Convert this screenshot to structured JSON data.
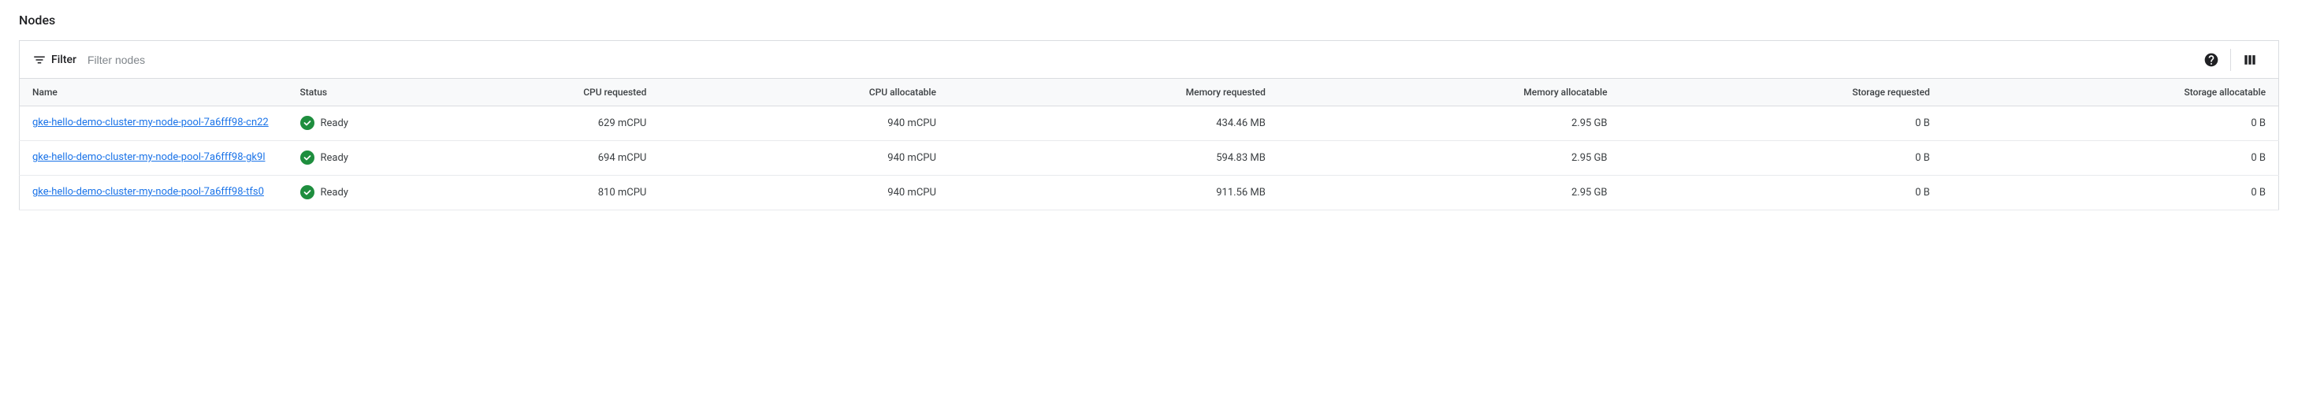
{
  "section_title": "Nodes",
  "toolbar": {
    "filter_label": "Filter",
    "filter_placeholder": "Filter nodes"
  },
  "table": {
    "headers": {
      "name": "Name",
      "status": "Status",
      "cpu_requested": "CPU requested",
      "cpu_allocatable": "CPU allocatable",
      "memory_requested": "Memory requested",
      "memory_allocatable": "Memory allocatable",
      "storage_requested": "Storage requested",
      "storage_allocatable": "Storage allocatable"
    },
    "rows": [
      {
        "name": "gke-hello-demo-cluster-my-node-pool-7a6fff98-cn22",
        "status": "Ready",
        "cpu_requested": "629 mCPU",
        "cpu_allocatable": "940 mCPU",
        "memory_requested": "434.46 MB",
        "memory_allocatable": "2.95 GB",
        "storage_requested": "0 B",
        "storage_allocatable": "0 B"
      },
      {
        "name": "gke-hello-demo-cluster-my-node-pool-7a6fff98-gk9l",
        "status": "Ready",
        "cpu_requested": "694 mCPU",
        "cpu_allocatable": "940 mCPU",
        "memory_requested": "594.83 MB",
        "memory_allocatable": "2.95 GB",
        "storage_requested": "0 B",
        "storage_allocatable": "0 B"
      },
      {
        "name": "gke-hello-demo-cluster-my-node-pool-7a6fff98-tfs0",
        "status": "Ready",
        "cpu_requested": "810 mCPU",
        "cpu_allocatable": "940 mCPU",
        "memory_requested": "911.56 MB",
        "memory_allocatable": "2.95 GB",
        "storage_requested": "0 B",
        "storage_allocatable": "0 B"
      }
    ]
  }
}
